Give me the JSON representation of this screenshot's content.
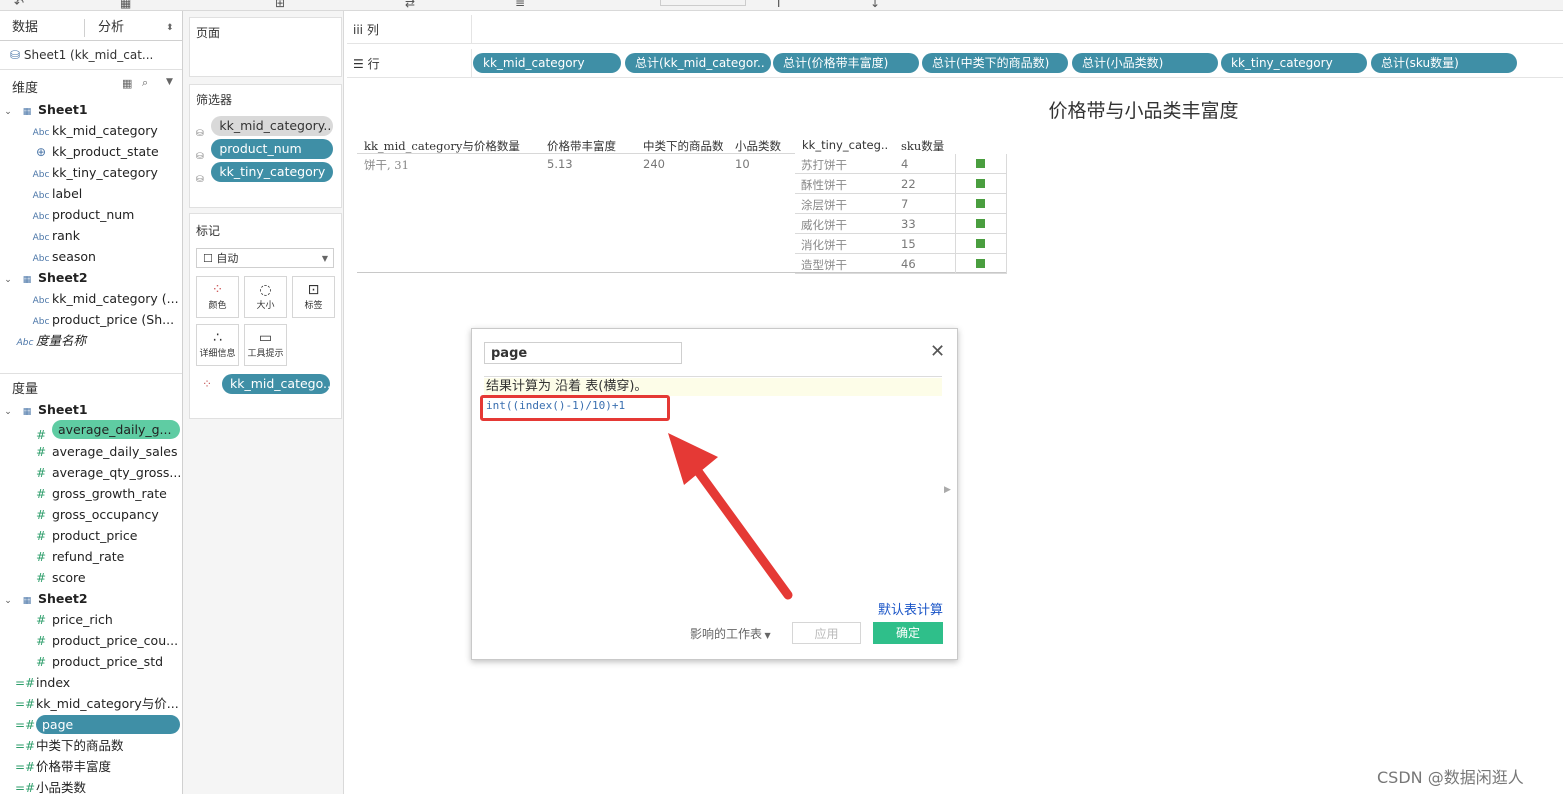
{
  "left_pane": {
    "tabs": [
      "数据",
      "分析"
    ],
    "datasource": "Sheet1 (kk_mid_cat...",
    "dimensions_header": "维度",
    "measures_header": "度量",
    "dimension_groups": [
      {
        "name": "Sheet1",
        "fields": [
          "kk_mid_category",
          "kk_product_state",
          "kk_tiny_category",
          "label",
          "product_num",
          "rank",
          "season"
        ]
      },
      {
        "name": "Sheet2",
        "fields": [
          "kk_mid_category (...",
          "product_price (Sh..."
        ]
      }
    ],
    "measure_names": "度量名称",
    "measure_groups": [
      {
        "name": "Sheet1",
        "fields": [
          "average_daily_g...",
          "average_daily_sales",
          "average_qty_gross...",
          "gross_growth_rate",
          "gross_occupancy",
          "product_price",
          "refund_rate",
          "score"
        ]
      },
      {
        "name": "Sheet2",
        "fields": [
          "price_rich",
          "product_price_cou...",
          "product_price_std"
        ]
      }
    ],
    "calculated_fields": [
      "index",
      "kk_mid_category与价...",
      "page",
      "中类下的商品数",
      "价格带丰富度",
      "小品类数"
    ]
  },
  "cards": {
    "pages_title": "页面",
    "filters_title": "筛选器",
    "filters": [
      "kk_mid_category..",
      "product_num",
      "kk_tiny_category"
    ],
    "marks_title": "标记",
    "mark_type": "自动",
    "mark_buttons": [
      "颜色",
      "大小",
      "标签",
      "详细信息",
      "工具提示"
    ],
    "mark_pill": "kk_mid_catego.."
  },
  "shelves": {
    "columns_label": "列",
    "rows_label": "行",
    "row_pills": [
      "kk_mid_category",
      "总计(kk_mid_categor..",
      "总计(价格带丰富度)",
      "总计(中类下的商品数)",
      "总计(小品类数)",
      "kk_tiny_category",
      "总计(sku数量)"
    ]
  },
  "view": {
    "title": "价格带与小品类丰富度",
    "headers": [
      "kk_mid_category与价格数量",
      "价格带丰富度",
      "中类下的商品数",
      "小品类数",
      "kk_tiny_categ..",
      "sku数量"
    ],
    "row": {
      "mid": "饼干, 31",
      "price_rich": "5.13",
      "goods": "240",
      "tiny_count": "10"
    },
    "tiny_rows": [
      {
        "name": "苏打饼干",
        "sku": "4"
      },
      {
        "name": "酥性饼干",
        "sku": "22"
      },
      {
        "name": "涂层饼干",
        "sku": "7"
      },
      {
        "name": "威化饼干",
        "sku": "33"
      },
      {
        "name": "消化饼干",
        "sku": "15"
      },
      {
        "name": "造型饼干",
        "sku": "46"
      }
    ]
  },
  "dialog": {
    "calc_name": "page",
    "info_text": "结果计算为 沿着 表(横穿)。",
    "formula": "int((index()-1)/10)+1",
    "default_table_calc": "默认表计算",
    "affected_sheets": "影响的工作表",
    "apply": "应用",
    "ok": "确定",
    "highlight_color": "#e53935",
    "ok_color": "#2fbf8a"
  },
  "watermark": "CSDN @数据闲逛人",
  "colors": {
    "pill_blue": "#3f8fa6",
    "pill_green": "#5fcca3",
    "mark_green": "#4a9e3f"
  }
}
